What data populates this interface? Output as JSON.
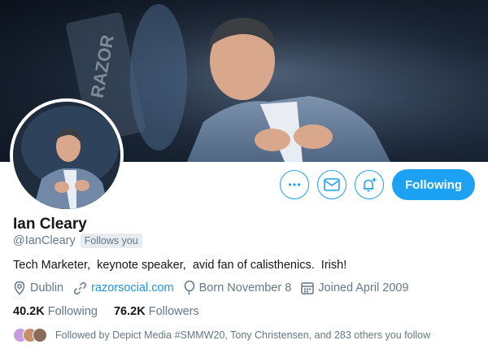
{
  "profile": {
    "name": "Ian Cleary",
    "handle": "@IanCleary",
    "follows_you": "Follows you",
    "bio": "Tech Marketer,  keynote speaker,  avid fan of calisthenics.  Irish!",
    "location": "Dublin",
    "website": "razorsocial.com",
    "born": "Born November 8",
    "joined": "Joined April 2009"
  },
  "stats": {
    "following_count": "40.2K",
    "following_label": "Following",
    "followers_count": "76.2K",
    "followers_label": "Followers"
  },
  "followed_by": "Followed by Depict Media #SMMW20, Tony Christensen, and 283 others you follow",
  "actions": {
    "more_icon": "more-icon",
    "message_icon": "envelope-icon",
    "notify_icon": "bell-plus-icon",
    "following_label": "Following"
  },
  "colors": {
    "accent": "#1da1f2",
    "link": "#1b95e0",
    "secondary_text": "#657786"
  }
}
